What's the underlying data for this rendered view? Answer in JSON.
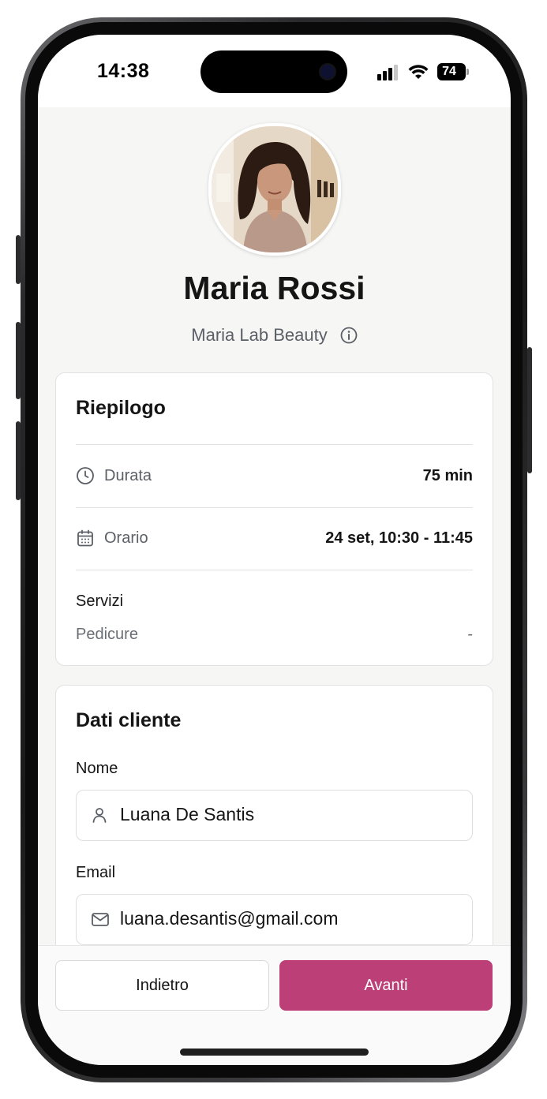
{
  "status_bar": {
    "time": "14:38",
    "battery": "74",
    "icons": [
      "signal-icon",
      "wifi-icon",
      "battery-icon"
    ]
  },
  "profile": {
    "name": "Maria Rossi",
    "business": "Maria Lab Beauty",
    "info_icon": "info-icon"
  },
  "summary": {
    "title": "Riepilogo",
    "duration_label": "Durata",
    "duration_value": "75 min",
    "time_label": "Orario",
    "time_value": "24 set, 10:30 - 11:45",
    "services_label": "Servizi",
    "service_name": "Pedicure",
    "service_price": "-",
    "icons": [
      "clock-icon",
      "calendar-icon"
    ]
  },
  "client": {
    "title": "Dati cliente",
    "name_label": "Nome",
    "name_value": "Luana De Santis",
    "email_label": "Email",
    "email_value": "luana.desantis@gmail.com",
    "icons": [
      "user-icon",
      "mail-icon"
    ]
  },
  "footer": {
    "back_label": "Indietro",
    "next_label": "Avanti"
  },
  "colors": {
    "accent": "#bc3f78",
    "background": "#f6f6f5",
    "card": "#ffffff",
    "text": "#151515",
    "muted": "#5b5f66"
  }
}
